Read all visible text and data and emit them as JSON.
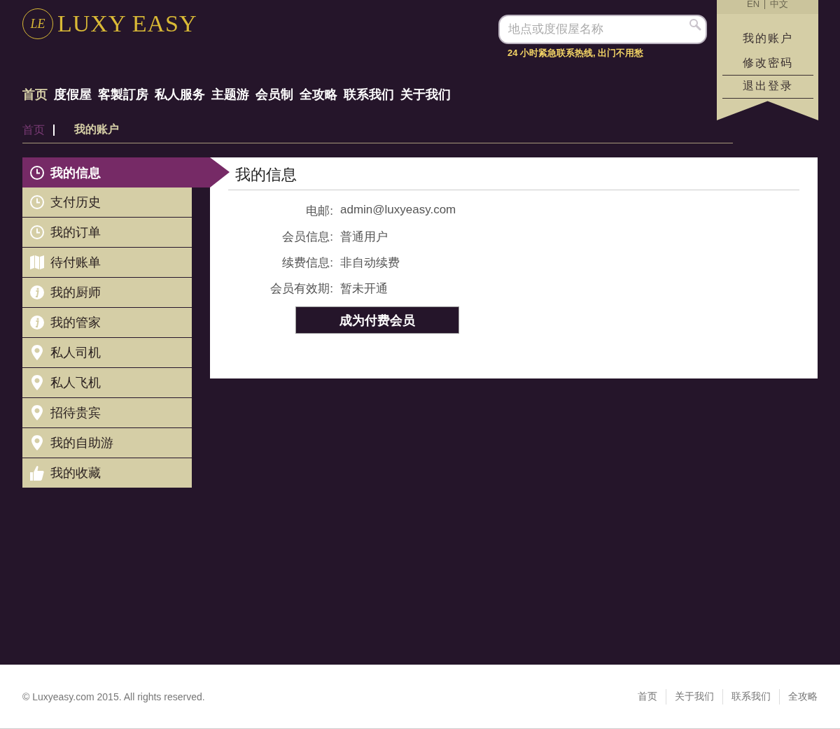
{
  "logo": {
    "monogram": "LE",
    "name": "LUXY EASY"
  },
  "search": {
    "placeholder": "地点或度假屋名称"
  },
  "hotline": "24 小时紧急联系热线, 出门不用愁",
  "language": [
    "EN",
    "中文"
  ],
  "account_menu": [
    {
      "label": "我的账户",
      "underlined": false
    },
    {
      "label": "修改密码",
      "underlined": true
    },
    {
      "label": "退出登录",
      "underlined": true
    }
  ],
  "nav": [
    {
      "label": "首页",
      "selected": true
    },
    {
      "label": "度假屋",
      "selected": false
    },
    {
      "label": "客製訂房",
      "selected": false
    },
    {
      "label": "私人服务",
      "selected": false
    },
    {
      "label": "主题游",
      "selected": false
    },
    {
      "label": "会员制",
      "selected": false
    },
    {
      "label": "全攻略",
      "selected": false
    },
    {
      "label": "联系我们",
      "selected": false
    },
    {
      "label": "关于我们",
      "selected": false
    }
  ],
  "breadcrumb": [
    "首页",
    "我的账户"
  ],
  "sidebar": [
    {
      "label": "我的信息",
      "kind": "clock",
      "selected": true
    },
    {
      "label": "支付历史",
      "kind": "clock",
      "selected": false
    },
    {
      "label": "我的订单",
      "kind": "clock",
      "selected": false
    },
    {
      "label": "待付账单",
      "kind": "map",
      "selected": false
    },
    {
      "label": "我的厨师",
      "kind": "info",
      "selected": false
    },
    {
      "label": "我的管家",
      "kind": "info",
      "selected": false
    },
    {
      "label": "私人司机",
      "kind": "pin",
      "selected": false
    },
    {
      "label": "私人飞机",
      "kind": "pin",
      "selected": false
    },
    {
      "label": "招待贵宾",
      "kind": "pin",
      "selected": false
    },
    {
      "label": "我的自助游",
      "kind": "pin",
      "selected": false
    },
    {
      "label": "我的收藏",
      "kind": "thumb",
      "selected": false
    }
  ],
  "panel": {
    "title": "我的信息",
    "fields": [
      {
        "label": "电邮:",
        "value": "admin@luxyeasy.com"
      },
      {
        "label": "会员信息:",
        "value": "普通用户"
      },
      {
        "label": "续费信息:",
        "value": "非自动续费"
      },
      {
        "label": "会员有效期:",
        "value": "暂未开通"
      }
    ],
    "button": "成为付费会员"
  },
  "footer": {
    "copyright": "© Luxyeasy.com 2015. All rights reserved.",
    "links": [
      "首页",
      "关于我们",
      "联系我们",
      "全攻略"
    ]
  }
}
